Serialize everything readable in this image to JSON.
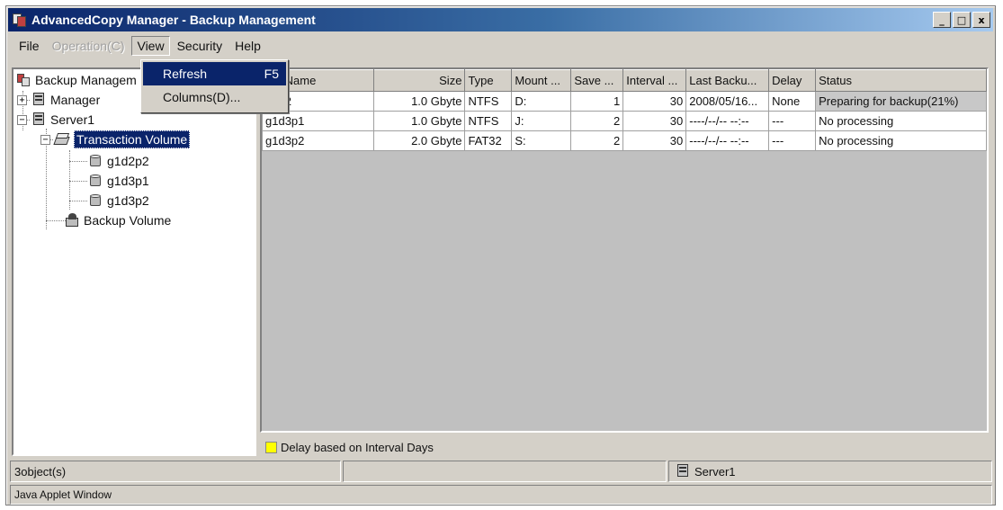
{
  "window": {
    "title": "AdvancedCopy Manager - Backup Management",
    "buttons": {
      "minimize": "_",
      "maximize": "□",
      "close": "x"
    }
  },
  "menubar": {
    "file": "File",
    "operation": "Operation(C)",
    "view": "View",
    "security": "Security",
    "help": "Help"
  },
  "view_menu": {
    "refresh_label": "Refresh",
    "refresh_shortcut": "F5",
    "columns_label": "Columns(D)..."
  },
  "tree": {
    "root": "Backup Managem",
    "manager": "Manager",
    "server": "Server1",
    "transaction_volume": "Transaction Volume",
    "volumes": [
      "g1d2p2",
      "g1d3p1",
      "g1d3p2"
    ],
    "backup_volume": "Backup Volume",
    "expander_plus": "+",
    "expander_minus": "−"
  },
  "table": {
    "headers": [
      "me Name",
      "Size",
      "Type",
      "Mount ...",
      "Save ...",
      "Interval ...",
      "Last Backu...",
      "Delay",
      "Status"
    ],
    "rows": [
      [
        "d2p2",
        "1.0 Gbyte",
        "NTFS",
        "D:",
        "1",
        "30",
        "2008/05/16...",
        "None",
        "Preparing for backup(21%)"
      ],
      [
        "g1d3p1",
        "1.0 Gbyte",
        "NTFS",
        "J:",
        "2",
        "30",
        "----/--/-- --:--",
        "---",
        "No processing"
      ],
      [
        "g1d3p2",
        "2.0 Gbyte",
        "FAT32",
        "S:",
        "2",
        "30",
        "----/--/-- --:--",
        "---",
        "No processing"
      ]
    ]
  },
  "legend": {
    "text": "Delay based on Interval Days",
    "color": "#ffff00"
  },
  "statusbar": {
    "objects": "3object(s)",
    "server": "Server1"
  },
  "applet_label": "Java Applet Window",
  "colors": {
    "title_start": "#0a246a",
    "selection": "#0a246a",
    "face": "#d4d0c8"
  }
}
